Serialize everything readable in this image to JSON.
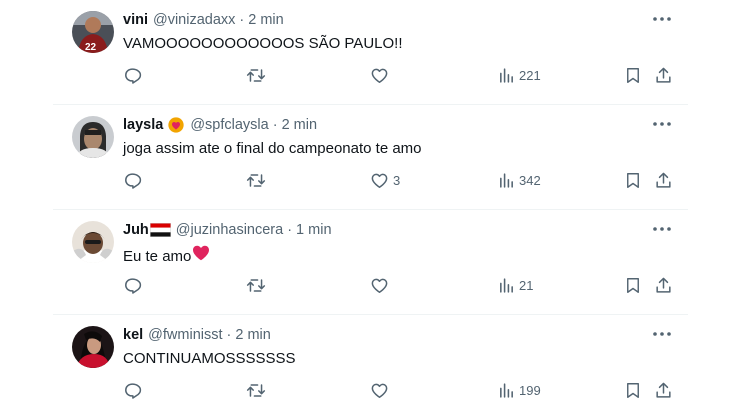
{
  "posts": [
    {
      "name": "vini",
      "handle": "@vinizadaxx",
      "time": "2 min",
      "text": "VAMOOOOOOOOOOOOS SÃO PAULO!!",
      "likes": "",
      "views": "221",
      "avatar_color": "#7a2a2a"
    },
    {
      "name": "laysla",
      "handle": "@spfclaysla",
      "time": "2 min",
      "text": "joga assim ate o final do campeonato te amo",
      "likes": "3",
      "views": "342",
      "avatar_color": "#8b8f94"
    },
    {
      "name": "Juh",
      "handle": "@juzinhasincera",
      "time": "1 min",
      "text": "Eu te amo",
      "likes": "",
      "views": "21",
      "avatar_color": "#6b5b4b"
    },
    {
      "name": "kel",
      "handle": "@fwminisst",
      "time": "2 min",
      "text": "CONTINUAMOSSSSSSS",
      "likes": "",
      "views": "199",
      "avatar_color": "#3a1a1a"
    }
  ],
  "separator": "·",
  "colors": {
    "text": "#0f1419",
    "secondary": "#536471",
    "divider": "#eff3f4",
    "heart": "#e0245e",
    "spfc_red": "#d90000"
  },
  "icons": [
    "more-icon",
    "reply-icon",
    "retweet-icon",
    "like-icon",
    "views-icon",
    "bookmark-icon",
    "share-icon",
    "heart-emoji-icon",
    "spfc-flag-icon",
    "verified-like-badge-icon"
  ]
}
